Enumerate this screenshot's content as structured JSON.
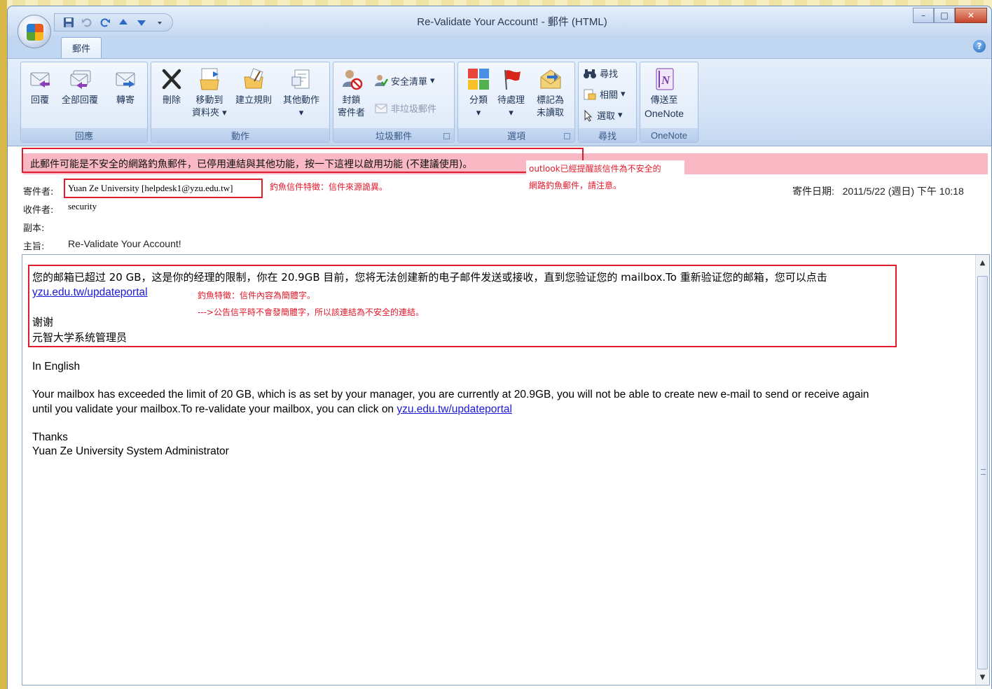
{
  "window": {
    "title": "Re-Validate Your Account! - 郵件 (HTML)"
  },
  "ribbon": {
    "tab_label": "郵件",
    "groups": {
      "respond": {
        "label": "回應",
        "reply": "回覆",
        "reply_all": "全部回覆",
        "forward": "轉寄"
      },
      "actions": {
        "label": "動作",
        "delete": "刪除",
        "move_line1": "移動到",
        "move_line2": "資料夾",
        "create_rule": "建立規則",
        "other_actions": "其他動作"
      },
      "junk": {
        "label": "垃圾郵件",
        "block_line1": "封鎖",
        "block_line2": "寄件者",
        "safe_list": "安全清單",
        "not_junk": "非垃圾郵件"
      },
      "options": {
        "label": "選項",
        "categorize": "分類",
        "follow_up": "待處理",
        "mark_unread_line1": "標記為",
        "mark_unread_line2": "未讀取"
      },
      "find": {
        "label": "尋找",
        "find": "尋找",
        "related": "相關",
        "select": "選取"
      },
      "onenote": {
        "label": "OneNote",
        "send_line1": "傳送至",
        "send_line2": "OneNote"
      }
    }
  },
  "infobar": {
    "text": "此郵件可能是不安全的網路釣魚郵件，已停用連結與其他功能，按一下這裡以啟用功能 (不建議使用)。"
  },
  "header": {
    "from_label": "寄件者:",
    "from_value": "Yuan Ze University [helpdesk1@yzu.edu.tw]",
    "to_label": "收件者:",
    "to_value": "security",
    "cc_label": "副本:",
    "subject_label": "主旨:",
    "subject_value": "Re-Validate Your Account!",
    "sent_label": "寄件日期:",
    "sent_value": "2011/5/22 (週日) 下午 10:18"
  },
  "annotations": {
    "sender_note": "釣魚信件特徵：信件來源詭異。",
    "outlook_note_line1": "outlook已經提醒該信件為不安全的",
    "outlook_note_line2": "網路釣魚郵件，請注意。",
    "body_note_line1": "釣魚特徵：信件內容為簡體字。",
    "body_note_line2": "--->公告信平時不會發簡體字，所以該連結為不安全的連結。"
  },
  "body": {
    "cn_line1": "您的邮箱已超过 20 GB，这是你的经理的限制，你在 20.9GB 目前，您将无法创建新的电子邮件发送或接收，直到您验证您的 mailbox.To 重新验证您的邮箱，您可以点击",
    "cn_link": "yzu.edu.tw/updateportal",
    "cn_thanks": "谢谢",
    "cn_signature": "元智大学系统管理员",
    "en_heading": "In English",
    "en_line1": "Your mailbox has exceeded the limit of 20 GB, which is as set by your manager, you are currently at 20.9GB, you will not be able to create new e-mail to send or receive again",
    "en_line2_prefix": "until you validate your mailbox.To re-validate your mailbox, you can click on ",
    "en_link": "yzu.edu.tw/updateportal",
    "en_thanks": "Thanks",
    "en_signature": "Yuan Ze University System Administrator"
  },
  "colors": {
    "infobar_bg": "#f9b8c4",
    "annotation_red": "#e11c2c",
    "link_blue": "#1a19d6"
  }
}
